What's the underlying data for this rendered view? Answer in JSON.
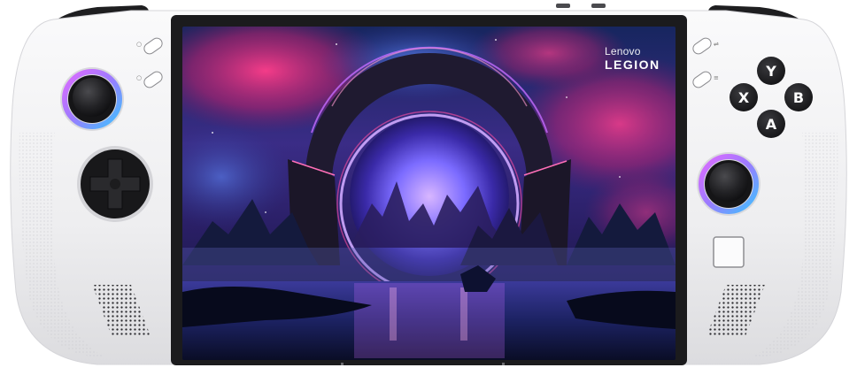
{
  "device": {
    "brand_line1": "Lenovo",
    "brand_line2": "LEGION",
    "face_buttons": [
      "Y",
      "X",
      "B",
      "A"
    ],
    "colors": {
      "body": "#f1f1f3",
      "bezel": "#1b1b1d",
      "sky_top": "#1b2d6e",
      "sky_magenta": "#d52575",
      "ring_glow": "#b46bff",
      "stick_ring_purple": "#c56bff",
      "stick_ring_blue": "#55b7ff"
    }
  }
}
